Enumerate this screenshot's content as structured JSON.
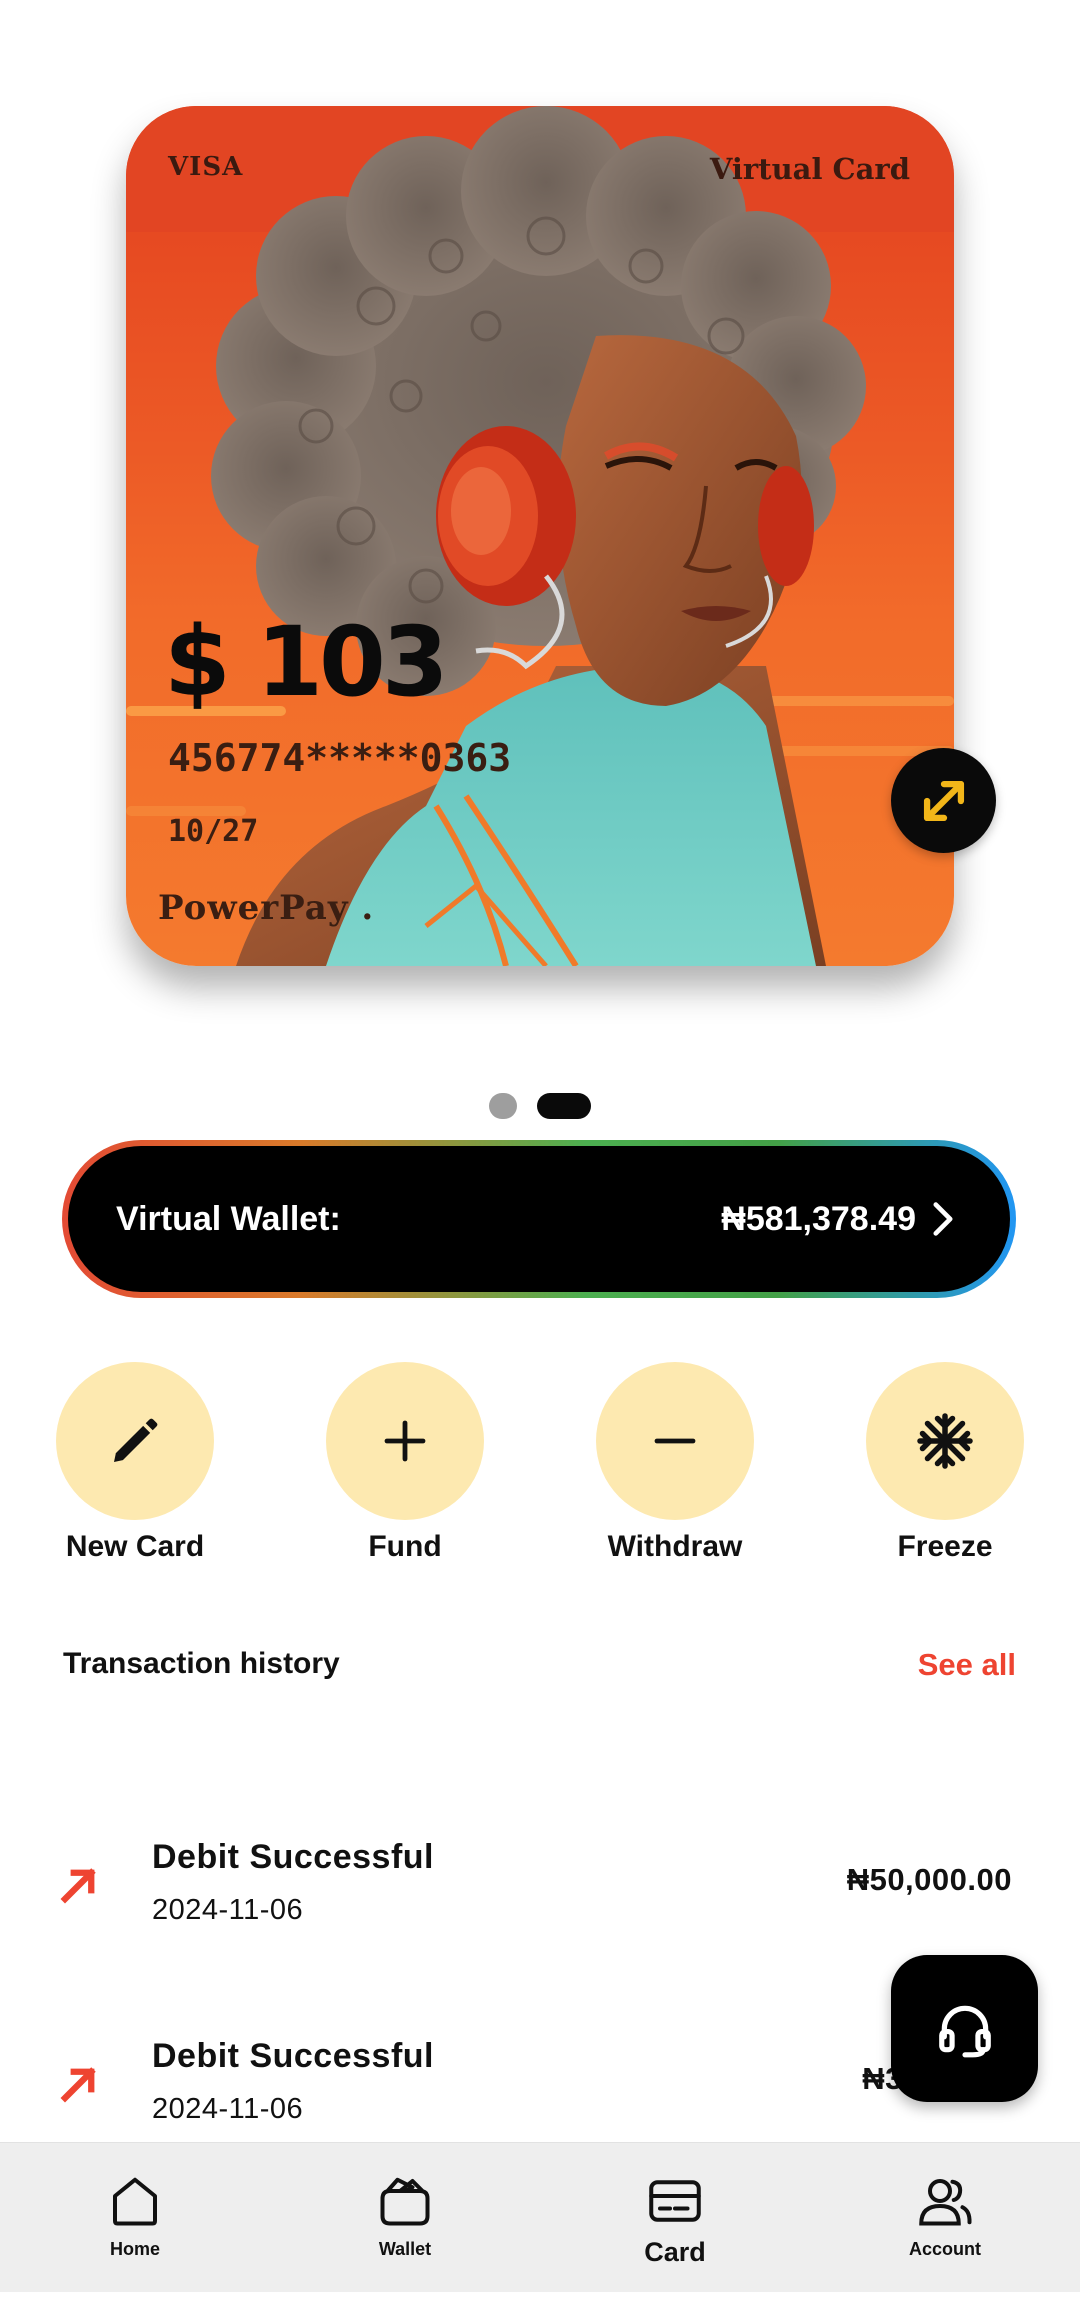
{
  "card": {
    "brand": "VISA",
    "type": "Virtual Card",
    "balance": "$ 103",
    "number": "456774*****0363",
    "expiry": "10/27",
    "issuer": "PowerPay ."
  },
  "pager": {
    "current": 2,
    "total": 2
  },
  "wallet": {
    "label": "Virtual Wallet:",
    "amount": "₦581,378.49"
  },
  "actions": [
    {
      "label": "New Card",
      "icon": "pencil-icon"
    },
    {
      "label": "Fund",
      "icon": "plus-icon"
    },
    {
      "label": "Withdraw",
      "icon": "minus-icon"
    },
    {
      "label": "Freeze",
      "icon": "snowflake-icon"
    }
  ],
  "transactions": {
    "title": "Transaction history",
    "see_all": "See all",
    "items": [
      {
        "name": "Debit Successful",
        "date": "2024-11-06",
        "amount": "₦50,000.00"
      },
      {
        "name": "Debit Successful",
        "date": "2024-11-06",
        "amount": "₦3,"
      }
    ]
  },
  "nav": {
    "items": [
      {
        "label": "Home",
        "icon": "home-icon"
      },
      {
        "label": "Wallet",
        "icon": "wallet-icon"
      },
      {
        "label": "Card",
        "icon": "card-icon",
        "active": true
      },
      {
        "label": "Account",
        "icon": "account-icon"
      }
    ]
  },
  "colors": {
    "accent": "#ee4431",
    "action_bg": "#fde9b0",
    "expand_icon": "#f2b619"
  }
}
